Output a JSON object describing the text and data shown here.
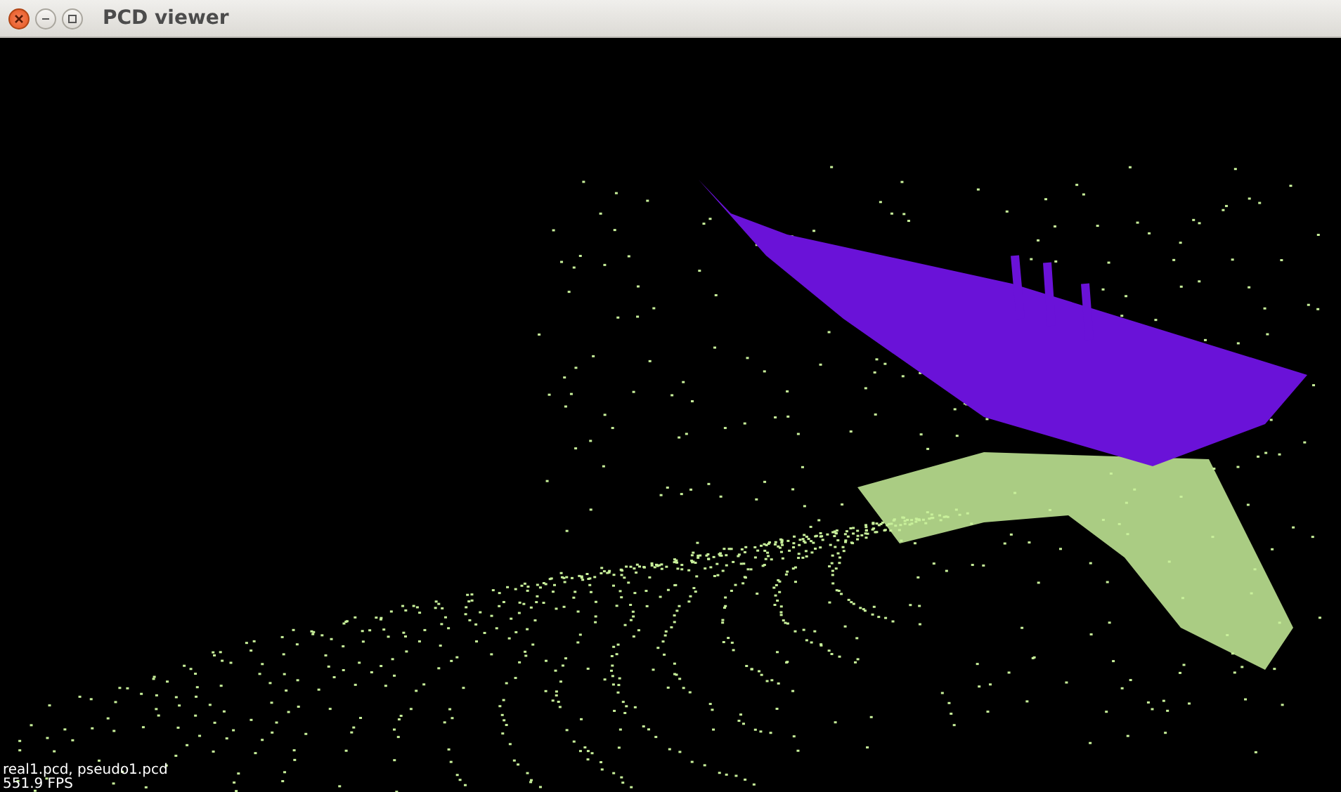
{
  "window": {
    "title": "PCD viewer"
  },
  "viewport": {
    "cloud_labels": "real1.pcd, pseudo1.pcd",
    "fps": "551.9 FPS"
  }
}
